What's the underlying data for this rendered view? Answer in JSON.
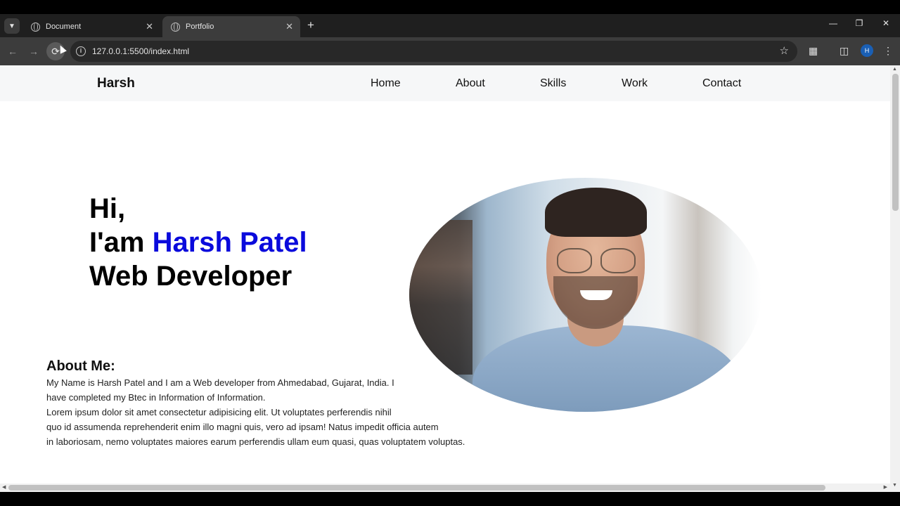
{
  "browser": {
    "tabs": [
      {
        "title": "Document",
        "active": false
      },
      {
        "title": "Portfolio",
        "active": true
      }
    ],
    "url": "127.0.0.1:5500/index.html",
    "profile_initial": "H"
  },
  "site": {
    "logo": "Harsh",
    "nav": [
      "Home",
      "About",
      "Skills",
      "Work",
      "Contact"
    ]
  },
  "hero": {
    "line1": "Hi,",
    "line2_prefix": "I'am ",
    "line2_name": "Harsh Patel",
    "line3": "Web Developer",
    "accent_color": "#0a0adc"
  },
  "about": {
    "title": "About Me:",
    "lines": [
      "My Name is Harsh Patel and I am a Web developer from Ahmedabad, Gujarat, India. I",
      "have completed my Btec in Information of Information.",
      "Lorem ipsum dolor sit amet consectetur adipisicing elit. Ut voluptates perferendis nihil",
      "quo id assumenda reprehenderit enim illo magni quis, vero ad ipsam! Natus impedit officia autem",
      "in laboriosam, nemo voluptates maiores earum perferendis ullam eum quasi, quas voluptatem voluptas."
    ]
  },
  "icons": {
    "tab_search": "chevron-down-icon",
    "new_tab": "plus-icon",
    "back": "arrow-left-icon",
    "forward": "arrow-right-icon",
    "reload": "reload-icon",
    "site_info": "info-icon",
    "bookmark": "star-icon",
    "extensions": "puzzle-icon",
    "side_panel": "side-panel-icon",
    "menu": "more-vertical-icon"
  }
}
